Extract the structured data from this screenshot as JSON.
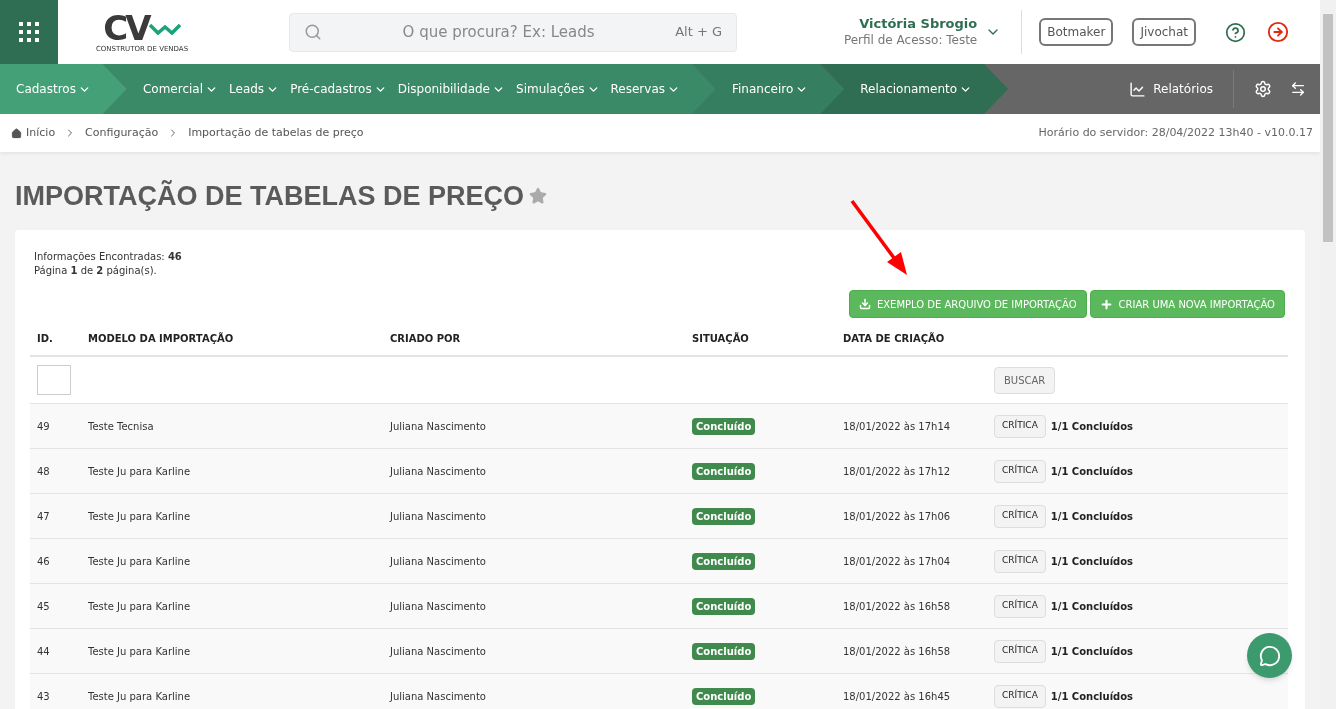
{
  "header": {
    "logo": {
      "mark": "CV",
      "tagline": "CONSTRUTOR DE VENDAS"
    },
    "search": {
      "placeholder": "O que procura? Ex: Leads",
      "shortcut": "Alt + G"
    },
    "user": {
      "name": "Victória Sbrogio",
      "profile": "Perfil de Acesso: Teste"
    },
    "buttons": [
      "Botmaker",
      "Jivochat"
    ]
  },
  "nav": {
    "segments": [
      {
        "color": "#43a077",
        "items": [
          "Cadastros"
        ]
      },
      {
        "color": "#3a8a67",
        "items": [
          "Comercial",
          "Leads",
          "Pré-cadastros",
          "Disponibilidade",
          "Simulações",
          "Reservas"
        ]
      },
      {
        "color": "#357f60",
        "items": [
          "Financeiro"
        ]
      },
      {
        "color": "#2f6e52",
        "items": [
          "Relacionamento"
        ]
      }
    ],
    "reports": "Relatórios"
  },
  "breadcrumb": [
    "Início",
    "Configuração",
    "Importação de tabelas de preço"
  ],
  "server_time": "Horário do servidor: 28/04/2022 13h40 - v10.0.17",
  "page_title": "IMPORTAÇÃO DE TABELAS DE PREÇO",
  "info": [
    "Informações Encontradas: **46**",
    "Página **1** de **2** página(s)."
  ],
  "actions": [
    "EXEMPLO DE ARQUIVO DE IMPORTAÇÃO",
    "CRIAR UMA NOVA IMPORTAÇÃO"
  ],
  "table": {
    "columns": [
      "ID.",
      "MODELO DA IMPORTAÇÃO",
      "CRIADO POR",
      "SITUAÇÃO",
      "DATA DE CRIAÇÃO"
    ],
    "search_button": "BUSCAR",
    "rows": [
      {
        "id": "49",
        "model": "Teste Tecnisa",
        "created_by": "Juliana Nascimento",
        "status": "Concluído",
        "date": "18/01/2022 às 17h14",
        "action": "CRÍTICA",
        "progress": "1/1 Concluídos"
      },
      {
        "id": "48",
        "model": "Teste Ju para Karline",
        "created_by": "Juliana Nascimento",
        "status": "Concluído",
        "date": "18/01/2022 às 17h12",
        "action": "CRÍTICA",
        "progress": "1/1 Concluídos"
      },
      {
        "id": "47",
        "model": "Teste Ju para Karline",
        "created_by": "Juliana Nascimento",
        "status": "Concluído",
        "date": "18/01/2022 às 17h06",
        "action": "CRÍTICA",
        "progress": "1/1 Concluídos"
      },
      {
        "id": "46",
        "model": "Teste Ju para Karline",
        "created_by": "Juliana Nascimento",
        "status": "Concluído",
        "date": "18/01/2022 às 17h04",
        "action": "CRÍTICA",
        "progress": "1/1 Concluídos"
      },
      {
        "id": "45",
        "model": "Teste Ju para Karline",
        "created_by": "Juliana Nascimento",
        "status": "Concluído",
        "date": "18/01/2022 às 16h58",
        "action": "CRÍTICA",
        "progress": "1/1 Concluídos"
      },
      {
        "id": "44",
        "model": "Teste Ju para Karline",
        "created_by": "Juliana Nascimento",
        "status": "Concluído",
        "date": "18/01/2022 às 16h58",
        "action": "CRÍTICA",
        "progress": "1/1 Concluídos"
      },
      {
        "id": "43",
        "model": "Teste Ju para Karline",
        "created_by": "Juliana Nascimento",
        "status": "Concluído",
        "date": "18/01/2022 às 16h45",
        "action": "CRÍTICA",
        "progress": "1/1 Concluídos"
      }
    ]
  }
}
